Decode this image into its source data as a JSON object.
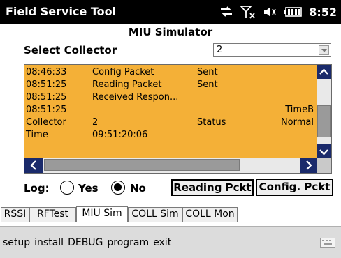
{
  "window": {
    "app_title": "Field Service Tool",
    "clock": "8:52",
    "status_icons": [
      "connectivity-icon",
      "no-signal-icon",
      "speaker-icon",
      "battery-icon"
    ]
  },
  "screen": {
    "title": "MIU Simulator",
    "collector": {
      "label": "Select Collector",
      "selected": "2"
    }
  },
  "log": {
    "rows": [
      {
        "c1": "08:46:33",
        "c2": "Config Packet",
        "c3": "Sent",
        "c4": ""
      },
      {
        "c1": "08:51:25",
        "c2": "Reading Packet",
        "c3": "Sent",
        "c4": ""
      },
      {
        "c1": "08:51:25",
        "c2": "Received Respon...",
        "c3": "",
        "c4": ""
      },
      {
        "c1": "08:51:25",
        "c2": "",
        "c3": "",
        "c4": "TimeB"
      },
      {
        "c1": "Collector",
        "c2": "2",
        "c3": "Status",
        "c4": "Normal"
      },
      {
        "c1": "Time",
        "c2": "09:51:20:06",
        "c3": "",
        "c4": ""
      }
    ]
  },
  "controls": {
    "log_label": "Log:",
    "yes_label": "Yes",
    "no_label": "No",
    "log_selected": "No",
    "reading_button": "Reading Pckt",
    "config_button": "Config. Pckt"
  },
  "tabs": [
    {
      "label": "RSSI",
      "active": false
    },
    {
      "label": "RFTest",
      "active": false
    },
    {
      "label": "MIU Sim",
      "active": true
    },
    {
      "label": "COLL Sim",
      "active": false
    },
    {
      "label": "COLL Mon",
      "active": false
    }
  ],
  "menu": {
    "items": [
      "setup",
      "install",
      "DEBUG",
      "program",
      "exit"
    ]
  },
  "colors": {
    "log_background": "#f4b037",
    "scroll_button": "#1a2a6b",
    "title_bar": "#000000"
  }
}
